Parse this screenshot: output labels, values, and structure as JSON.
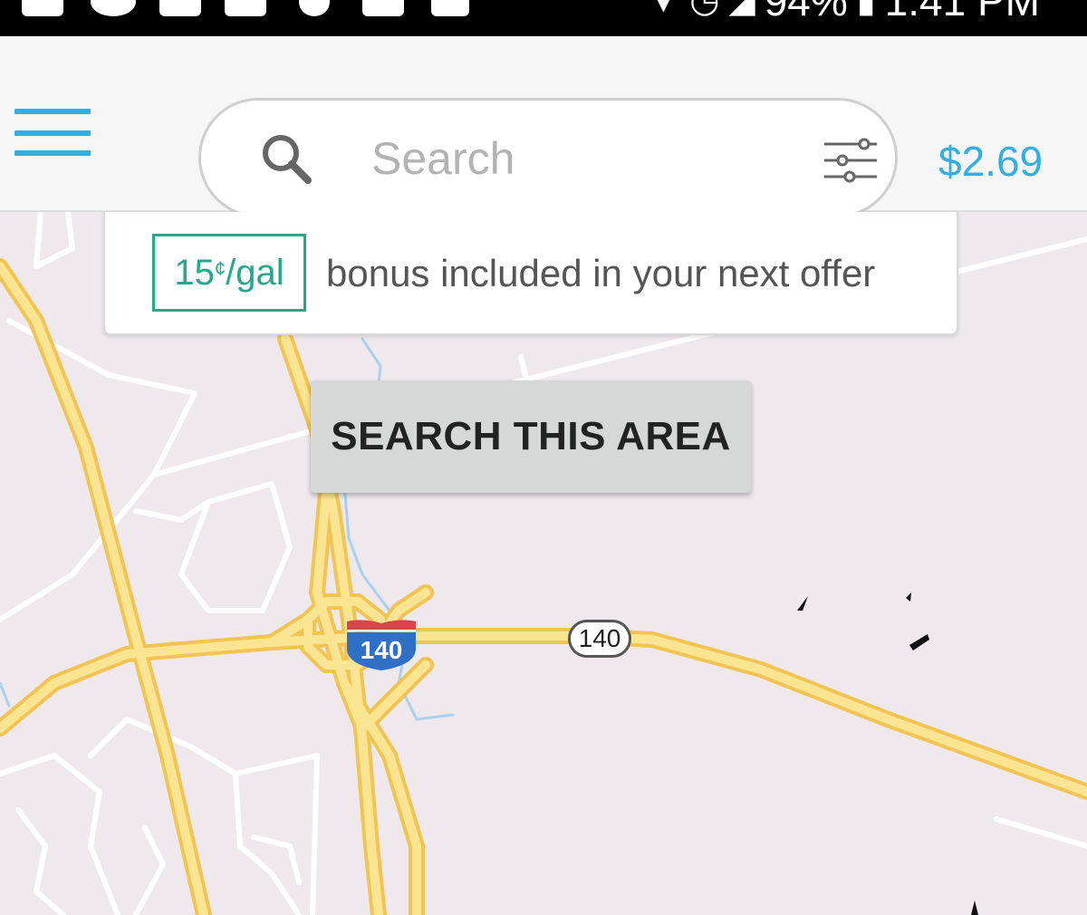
{
  "status_bar": {
    "battery": "94%",
    "time": "1:41 PM"
  },
  "header": {
    "menu_icon": "hamburger-menu-icon",
    "search": {
      "placeholder": "Search",
      "value": "",
      "icon": "search-icon",
      "filter_icon": "sliders-filter-icon"
    },
    "price": "$2.69"
  },
  "bonus": {
    "amount": "15",
    "unit_symbol": "¢",
    "unit": "/gal",
    "text": "bonus included in your next offer"
  },
  "map": {
    "search_area_label": "SEARCH THIS AREA",
    "interstate_label": "140",
    "route_label": "140"
  },
  "colors": {
    "accent": "#33aee2",
    "bonus_green": "#26a98a",
    "highway_yellow": "#f7d66e",
    "map_background": "#efe9ed"
  }
}
